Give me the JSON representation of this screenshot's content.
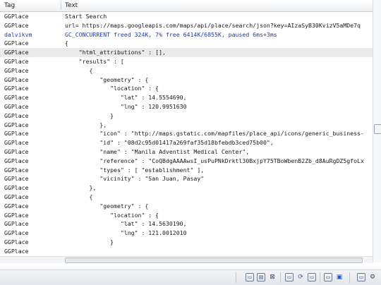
{
  "columns": {
    "tag": "Tag",
    "text": "Text"
  },
  "rows": [
    {
      "tag": "GGPlace",
      "text": "Start Search"
    },
    {
      "tag": "GGPlace",
      "text": "url= https://maps.googleapis.com/maps/api/place/search/json?key=AIzaSyB30KvizV5aMDe7q"
    },
    {
      "tag": "dalvikvm",
      "text": "GC_CONCURRENT freed 324K, 7% free 6414K/6855K, paused 6ms+3ms",
      "style": "blue"
    },
    {
      "tag": "GGPlace",
      "text": "{"
    },
    {
      "tag": "GGPlace",
      "text": "    \"html_attributions\" : [],",
      "selected": true
    },
    {
      "tag": "GGPlace",
      "text": "    \"results\" : ["
    },
    {
      "tag": "GGPlace",
      "text": "       {"
    },
    {
      "tag": "GGPlace",
      "text": "          \"geometry\" : {"
    },
    {
      "tag": "GGPlace",
      "text": "             \"location\" : {"
    },
    {
      "tag": "GGPlace",
      "text": "                \"lat\" : 14.5554690,"
    },
    {
      "tag": "GGPlace",
      "text": "                \"lng\" : 120.9951630"
    },
    {
      "tag": "GGPlace",
      "text": "             }"
    },
    {
      "tag": "GGPlace",
      "text": "          },"
    },
    {
      "tag": "GGPlace",
      "text": "          \"icon\" : \"http://maps.gstatic.com/mapfiles/place_api/icons/generic_business-"
    },
    {
      "tag": "GGPlace",
      "text": "          \"id\" : \"08d2c95d01417a269faf35d18bfebdb3ced75b00\","
    },
    {
      "tag": "GGPlace",
      "text": "          \"name\" : \"Manila Adventist Medical Center\","
    },
    {
      "tag": "GGPlace",
      "text": "          \"reference\" : \"CoQBdgAAAAwsI_usPuPNkDrktl30BxjpY75TBoWbenB2Zb_d8AuRgDZ5gfoLx"
    },
    {
      "tag": "GGPlace",
      "text": "          \"types\" : [ \"establishment\" ],"
    },
    {
      "tag": "GGPlace",
      "text": "          \"vicinity\" : \"San Juan, Pasay\""
    },
    {
      "tag": "GGPlace",
      "text": "       },"
    },
    {
      "tag": "GGPlace",
      "text": "       {"
    },
    {
      "tag": "GGPlace",
      "text": "          \"geometry\" : {"
    },
    {
      "tag": "GGPlace",
      "text": "             \"location\" : {"
    },
    {
      "tag": "GGPlace",
      "text": "                \"lat\" : 14.5630190,"
    },
    {
      "tag": "GGPlace",
      "text": "                \"lng\" : 121.0012010"
    },
    {
      "tag": "GGPlace",
      "text": "             }"
    },
    {
      "tag": "GGPlace",
      "text": ""
    }
  ],
  "toolbar": {
    "icons": [
      "window-icon",
      "window-split-icon",
      "close-window-icon",
      "window-icon",
      "refresh-icon",
      "new-window-icon",
      "window-icon",
      "monitor-icon",
      "window-icon",
      "settings-icon"
    ]
  },
  "colors": {
    "header_bg": "#eef0f3",
    "selected_row": "#e9eaec",
    "dalvik_text": "#1d3da8"
  }
}
